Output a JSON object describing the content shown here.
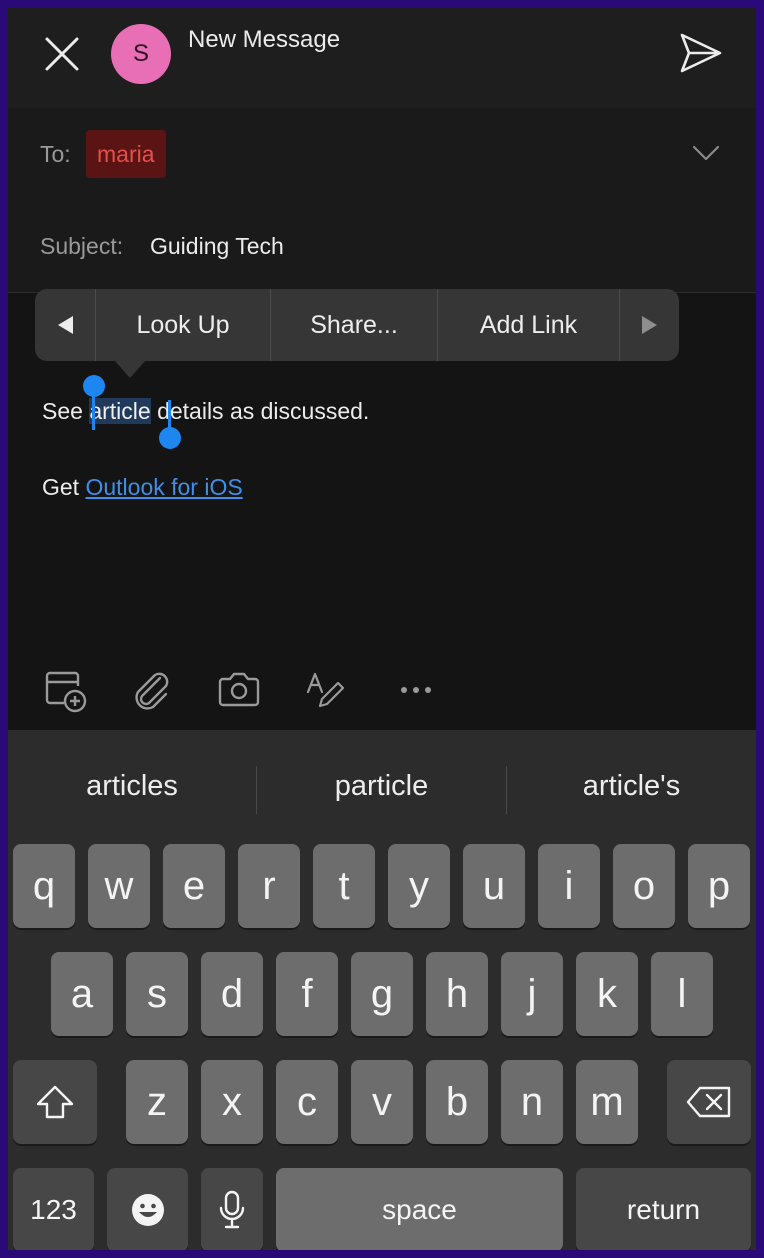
{
  "header": {
    "title": "New Message",
    "avatar_initial": "S"
  },
  "to": {
    "label": "To:",
    "recipient": "maria"
  },
  "subject": {
    "label": "Subject:",
    "value": "Guiding Tech"
  },
  "context_menu": {
    "look_up": "Look Up",
    "share": "Share...",
    "add_link": "Add Link"
  },
  "body": {
    "before": "See ",
    "selected": "article",
    "after": " details as discussed.",
    "signature_prefix": "Get ",
    "signature_link": "Outlook for iOS"
  },
  "keyboard": {
    "suggestions": [
      "articles",
      "particle",
      "article's"
    ],
    "row1": [
      "q",
      "w",
      "e",
      "r",
      "t",
      "y",
      "u",
      "i",
      "o",
      "p"
    ],
    "row2": [
      "a",
      "s",
      "d",
      "f",
      "g",
      "h",
      "j",
      "k",
      "l"
    ],
    "row3": [
      "z",
      "x",
      "c",
      "v",
      "b",
      "n",
      "m"
    ],
    "numbers_key": "123",
    "space_key": "space",
    "return_key": "return"
  },
  "colors": {
    "avatar": "#e86fb6",
    "recipient_chip_bg": "#5a1414",
    "recipient_chip_text": "#e6504a",
    "selection_handle": "#1e86f0",
    "link": "#3f8fe8"
  },
  "icons": {
    "close": "close-icon",
    "send": "send-icon",
    "expand": "chevron-down-icon",
    "toolbar": [
      "calendar-add-icon",
      "paperclip-icon",
      "camera-icon",
      "format-text-icon",
      "more-icon"
    ],
    "shift": "shift-icon",
    "backspace": "backspace-icon",
    "emoji": "emoji-icon",
    "mic": "microphone-icon"
  }
}
